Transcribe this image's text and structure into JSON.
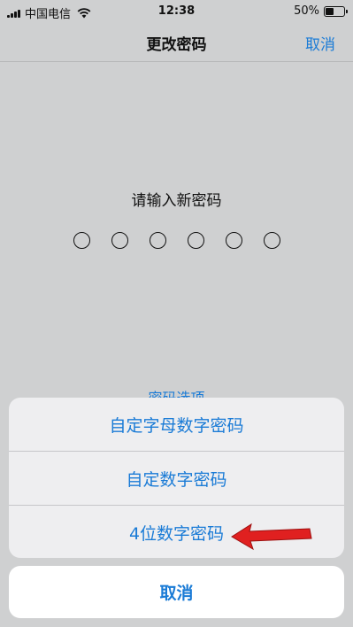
{
  "status_bar": {
    "carrier": "中国电信",
    "time": "12:38",
    "battery": "50%",
    "battery_level": 0.5
  },
  "nav": {
    "title": "更改密码",
    "cancel_label": "取消"
  },
  "content": {
    "prompt": "请输入新密码",
    "passcode_digits": 6,
    "options_label": "密码选项"
  },
  "action_sheet": {
    "items": [
      {
        "label": "自定字母数字密码"
      },
      {
        "label": "自定数字密码"
      },
      {
        "label": "4位数字密码"
      }
    ],
    "cancel_label": "取消"
  },
  "colors": {
    "accent": "#1a7bd6",
    "annotation_arrow": "#e02020",
    "overlay_background": "#cfd0d1"
  }
}
